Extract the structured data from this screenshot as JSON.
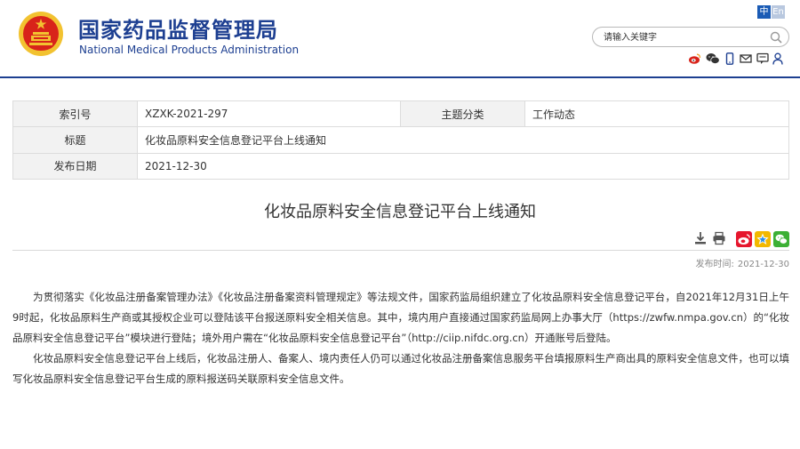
{
  "header": {
    "site_name_cn": "国家药品监督管理局",
    "site_name_en": "National Medical Products Administration",
    "lang_zh": "中",
    "lang_en": "En",
    "search_placeholder": "请输入关键字",
    "social_icons": [
      "weibo-icon",
      "wechat-icon",
      "mobile-icon",
      "email-icon",
      "message-icon",
      "user-icon"
    ]
  },
  "meta": {
    "index_label": "索引号",
    "index_value": "XZXK-2021-297",
    "category_label": "主题分类",
    "category_value": "工作动态",
    "title_label": "标题",
    "title_value": "化妆品原料安全信息登记平台上线通知",
    "date_label": "发布日期",
    "date_value": "2021-12-30"
  },
  "article": {
    "title": "化妆品原料安全信息登记平台上线通知",
    "publish_label": "发布时间:",
    "publish_value": "2021-12-30",
    "paragraphs": [
      "为贯彻落实《化妆品注册备案管理办法》《化妆品注册备案资料管理规定》等法规文件，国家药监局组织建立了化妆品原料安全信息登记平台，自2021年12月31日上午9时起，化妆品原料生产商或其授权企业可以登陆该平台报送原料安全相关信息。其中，境内用户直接通过国家药监局网上办事大厅（https://zwfw.nmpa.gov.cn）的“化妆品原料安全信息登记平台”模块进行登陆；境外用户需在“化妆品原料安全信息登记平台”（http://ciip.nifdc.org.cn）开通账号后登陆。",
      "化妆品原料安全信息登记平台上线后，化妆品注册人、备案人、境内责任人仍可以通过化妆品注册备案信息服务平台填报原料生产商出具的原料安全信息文件，也可以填写化妆品原料安全信息登记平台生成的原料报送码关联原料安全信息文件。"
    ]
  },
  "colors": {
    "brand_blue": "#1d3f91",
    "emblem_red": "#d8231a",
    "emblem_gold": "#f2c230"
  }
}
